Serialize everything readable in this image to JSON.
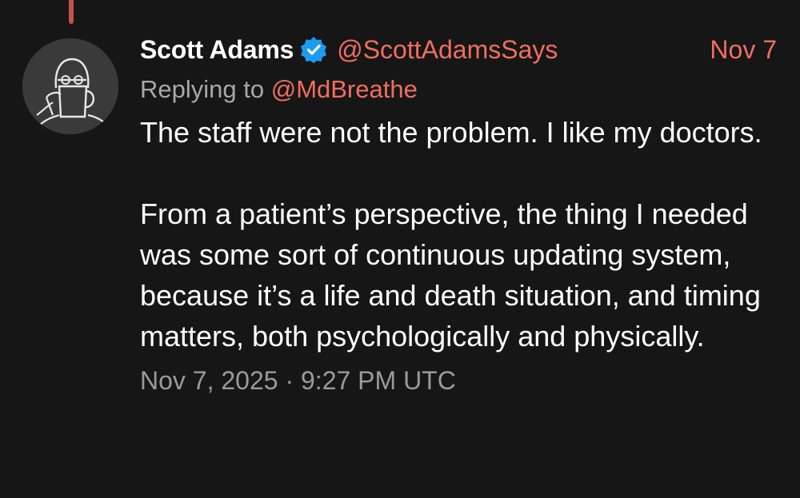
{
  "author": {
    "name": "Scott Adams",
    "handle": "@ScottAdamsSays",
    "verified_icon": "verified-badge-icon",
    "avatar_icon": "avatar-sketch-icon"
  },
  "date_short": "Nov 7",
  "reply": {
    "prefix": "Replying to",
    "handle": "@MdBreathe"
  },
  "body": {
    "paragraph_1": "The staff were not the problem. I like my doctors.",
    "paragraph_2": "From a patient’s perspective, the thing I needed was some sort of continuous updating system, because it’s a life and death situation, and timing matters, both psychologically and physically."
  },
  "timestamp": "Nov 7, 2025 · 9:27 PM UTC",
  "colors": {
    "background": "#161616",
    "accent": "#f06e5f",
    "verified": "#1d9bf0",
    "thread_line": "#c0524a",
    "muted": "#a8a8a8"
  }
}
